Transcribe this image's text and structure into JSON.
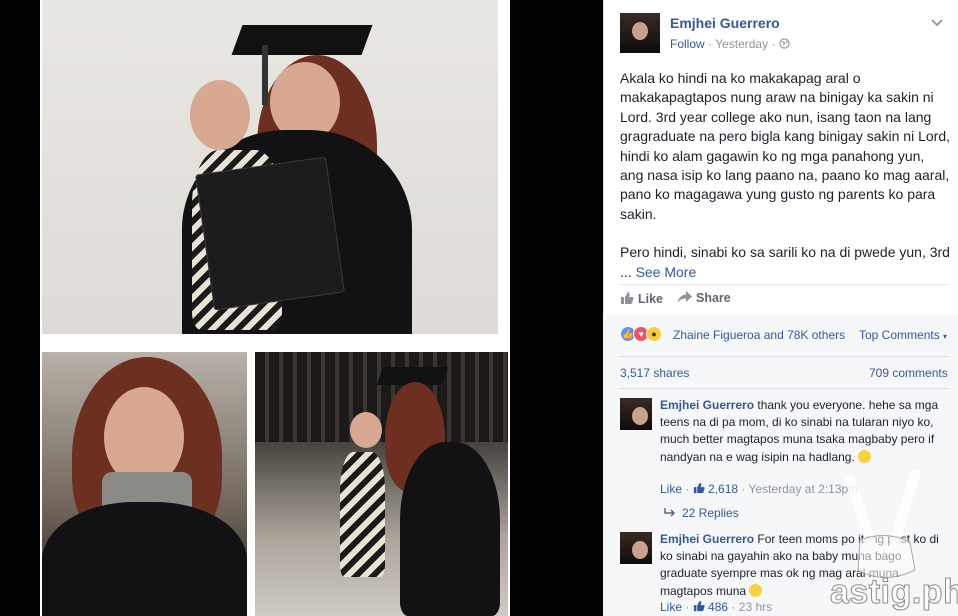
{
  "post": {
    "author": "Emjhei Guerrero",
    "follow_label": "Follow",
    "separator": "·",
    "time": "Yesterday",
    "privacy_icon": "globe-icon",
    "menu_icon": "chevron-down-icon",
    "paragraph1": "Akala ko hindi na ko makakapag aral o makakapagtapos nung araw na binigay ka sakin ni Lord. 3rd year college ako nun, isang taon na lang gragraduate na pero bigla kang binigay sakin ni Lord, hindi ko alam gagawin ko ng mga panahong yun, ang nasa isip ko lang paano na, paano ko mag aaral, pano ko magagawa yung gusto ng parents ko para sakin.",
    "paragraph2_start": "Pero hindi, sinabi ko sa sarili ko na di pwede yun, 3rd ... ",
    "see_more": "See More"
  },
  "actions": {
    "like": "Like",
    "share": "Share"
  },
  "reactions": {
    "names": "Zhaine Figueroa and 78K others",
    "top_comments": "Top Comments",
    "shares": "3,517 shares",
    "comments": "709 comments"
  },
  "comments": [
    {
      "author": "Emjhei Guerrero",
      "text": " thank you everyone. hehe sa mga teens na di pa mom, di ko sinabi na tularan niyo ko, much better magtapos muna tsaka magbaby pero if nandyan na e wag isipin na hadlang.",
      "like": "Like",
      "count": "2,618",
      "time": "Yesterday at 2:13pm",
      "replies": "22 Replies"
    },
    {
      "author": "Emjhei Guerrero",
      "text": " For teen moms po itong post ko di ko sinabi na gayahin ako na baby muna bago graduate syempre mas ok ng mag aral muna magtapos muna",
      "like": "Like",
      "count": "486",
      "time": "23 hrs"
    }
  ],
  "watermark": "astig.ph",
  "colors": {
    "link": "#365899",
    "text": "#1d2129",
    "meta": "#90949c",
    "like_reaction": "#5890ff"
  }
}
